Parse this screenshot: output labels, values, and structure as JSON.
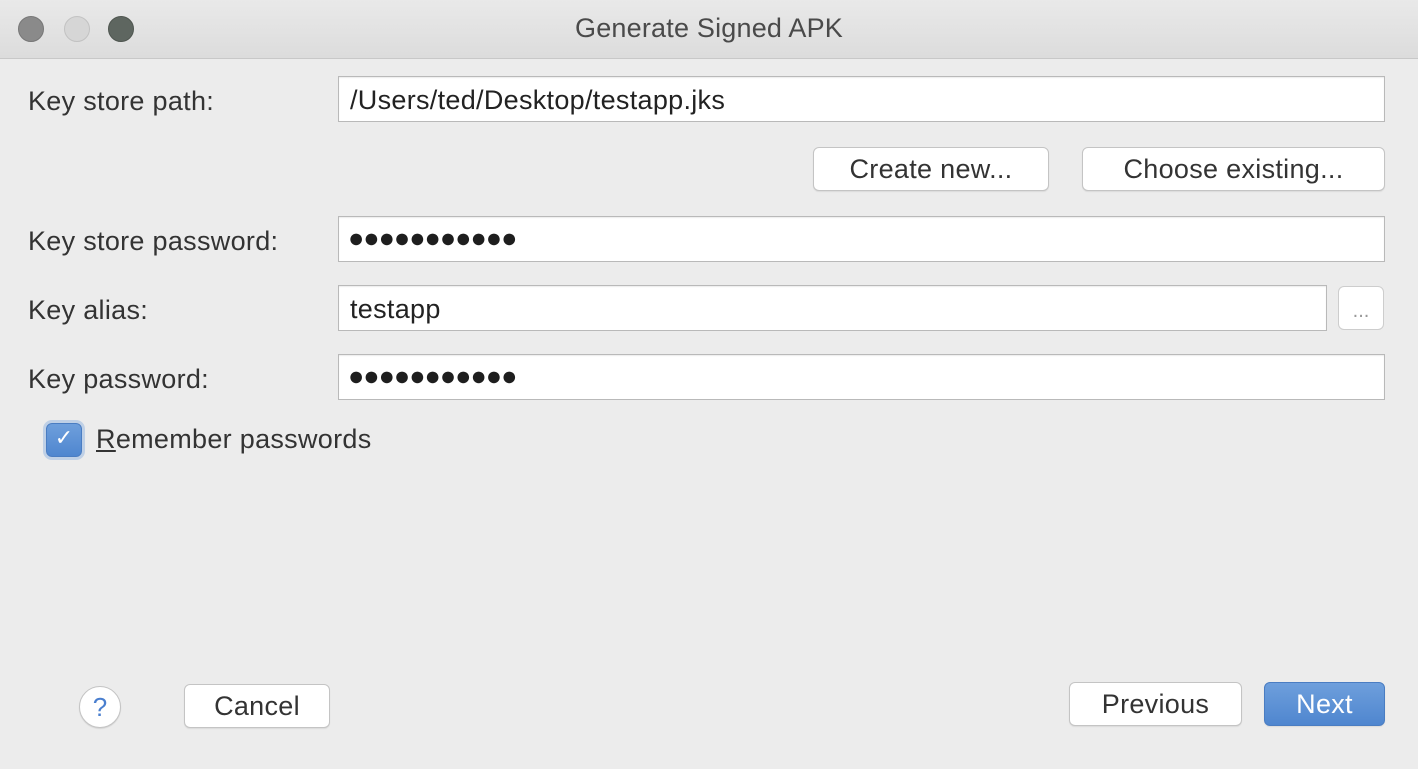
{
  "window": {
    "title": "Generate Signed APK"
  },
  "form": {
    "key_store_path_label": "Key store path:",
    "key_store_path_value": "/Users/ted/Desktop/testapp.jks",
    "create_new_label": "Create new...",
    "choose_existing_label": "Choose existing...",
    "key_store_password_label": "Key store password:",
    "key_store_password_mask": "●●●●●●●●●●●",
    "key_alias_label": "Key alias:",
    "key_alias_value": "testapp",
    "key_alias_browse_label": "...",
    "key_password_label": "Key password:",
    "key_password_mask": "●●●●●●●●●●●",
    "remember_passwords_first": "R",
    "remember_passwords_rest": "emember passwords",
    "remember_passwords_checked": true
  },
  "footer": {
    "help_label": "?",
    "cancel_label": "Cancel",
    "previous_label": "Previous",
    "next_label": "Next"
  },
  "colors": {
    "accent": "#5b8fd6",
    "background": "#ececec"
  },
  "icons": {
    "checkbox": "checkmark-icon",
    "help": "question-mark-icon"
  }
}
